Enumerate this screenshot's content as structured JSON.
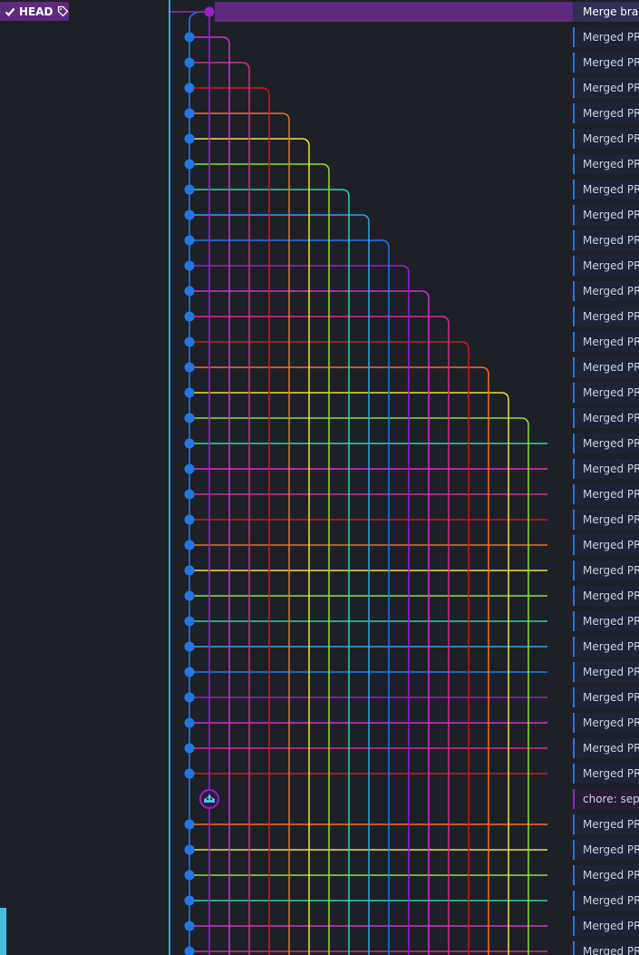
{
  "head_badge": {
    "label": "HEAD",
    "check_icon": "check-icon",
    "tag_icon": "tag-icon"
  },
  "colors": {
    "background": "#1e2027",
    "divider": "#2fa8d3",
    "main_branch": "#1f78e8",
    "head_branch": "#9a20c8",
    "row_band": "#1d2436",
    "head_row": "#5d2a7e",
    "lane_palette": [
      "#d62fd0",
      "#d32f8f",
      "#c81a1a",
      "#e8722a",
      "#f0e040",
      "#8ae040",
      "#2ed6a0",
      "#2aa6e8",
      "#1f78e8",
      "#9a20c8",
      "#d62fd0",
      "#d32f8f",
      "#c81a1a",
      "#e8722a",
      "#f0e040",
      "#8ae040",
      "#2ed6a0"
    ]
  },
  "commits": [
    {
      "message": "Merge bran",
      "type": "head"
    },
    {
      "message": "Merged PR",
      "type": "merge"
    },
    {
      "message": "Merged PR",
      "type": "merge"
    },
    {
      "message": "Merged PR",
      "type": "merge"
    },
    {
      "message": "Merged PR",
      "type": "merge"
    },
    {
      "message": "Merged PR",
      "type": "merge"
    },
    {
      "message": "Merged PR",
      "type": "merge"
    },
    {
      "message": "Merged PR",
      "type": "merge"
    },
    {
      "message": "Merged PR",
      "type": "merge"
    },
    {
      "message": "Merged PR",
      "type": "merge"
    },
    {
      "message": "Merged PR",
      "type": "merge"
    },
    {
      "message": "Merged PR",
      "type": "merge"
    },
    {
      "message": "Merged PR",
      "type": "merge"
    },
    {
      "message": "Merged PR",
      "type": "merge"
    },
    {
      "message": "Merged PR",
      "type": "merge"
    },
    {
      "message": "Merged PR",
      "type": "merge"
    },
    {
      "message": "Merged PR",
      "type": "merge"
    },
    {
      "message": "Merged PR",
      "type": "merge"
    },
    {
      "message": "Merged PR",
      "type": "merge"
    },
    {
      "message": "Merged PR",
      "type": "merge"
    },
    {
      "message": "Merged PR",
      "type": "merge"
    },
    {
      "message": "Merged PR",
      "type": "merge"
    },
    {
      "message": "Merged PR",
      "type": "merge"
    },
    {
      "message": "Merged PR",
      "type": "merge"
    },
    {
      "message": "Merged PR",
      "type": "merge"
    },
    {
      "message": "Merged PR",
      "type": "merge"
    },
    {
      "message": "Merged PR",
      "type": "merge"
    },
    {
      "message": "Merged PR",
      "type": "merge"
    },
    {
      "message": "Merged PR",
      "type": "merge"
    },
    {
      "message": "Merged PR",
      "type": "merge"
    },
    {
      "message": "Merged PR",
      "type": "merge"
    },
    {
      "message": "chore: sepa",
      "type": "chore"
    },
    {
      "message": "Merged PR",
      "type": "merge"
    },
    {
      "message": "Merged PR",
      "type": "merge"
    },
    {
      "message": "Merged PR",
      "type": "merge"
    },
    {
      "message": "Merged PR",
      "type": "merge"
    },
    {
      "message": "Merged PR",
      "type": "merge"
    },
    {
      "message": "Merged PR",
      "type": "merge"
    }
  ]
}
